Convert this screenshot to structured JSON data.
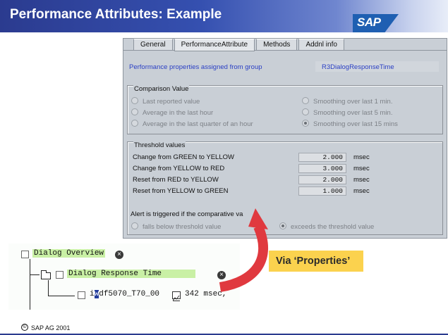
{
  "slide": {
    "title": "Performance Attributes: Example",
    "logo_text": "SAP",
    "copyright_symbol": "©",
    "copyright": "SAP AG 2001",
    "callout": "Via ‘Properties’"
  },
  "tabs": [
    {
      "label": "General",
      "active": false
    },
    {
      "label": "PerformanceAttribute",
      "active": true
    },
    {
      "label": "Methods",
      "active": false
    },
    {
      "label": "Addnl info",
      "active": false
    }
  ],
  "assignment": {
    "label": "Performance properties assigned from group",
    "value": "R3DialogResponseTime"
  },
  "comparison": {
    "title": "Comparison Value",
    "left_options": [
      {
        "label": "Last reported value",
        "checked": false
      },
      {
        "label": "Average in the last hour",
        "checked": false
      },
      {
        "label": "Average in the last quarter of an hour",
        "checked": false
      }
    ],
    "right_options": [
      {
        "label": "Smoothing over last 1 min.",
        "checked": false
      },
      {
        "label": "Smoothing over last 5 min.",
        "checked": false
      },
      {
        "label": "Smoothing over last 15 mins",
        "checked": true
      }
    ]
  },
  "thresholds": {
    "title": "Threshold values",
    "rows": [
      {
        "label": "Change from GREEN to YELLOW",
        "value": "2.000",
        "unit": "msec"
      },
      {
        "label": "Change from YELLOW to RED",
        "value": "3.000",
        "unit": "msec"
      },
      {
        "label": "Reset from RED to YELLOW",
        "value": "2.000",
        "unit": "msec"
      },
      {
        "label": "Reset from YELLOW to GREEN",
        "value": "1.000",
        "unit": "msec"
      }
    ],
    "alert_text": "Alert is triggered if the comparative va",
    "alert_options": [
      {
        "label": "falls below threshold value",
        "checked": false
      },
      {
        "label": "exceeds the threshold value",
        "checked": true
      }
    ]
  },
  "tree": {
    "root": "Dialog Overview",
    "child": "Dialog Response Time",
    "leaf_prefix": "i",
    "leaf_cursor": "w",
    "leaf_name": "df5070_T70_00",
    "leaf_value": "342 msec,"
  },
  "colors": {
    "header": "#2b3b8f",
    "highlight": "#c9f0a5",
    "callout": "#fbd24e",
    "arrow": "#e0393f",
    "link_text": "#2a3fc4"
  }
}
